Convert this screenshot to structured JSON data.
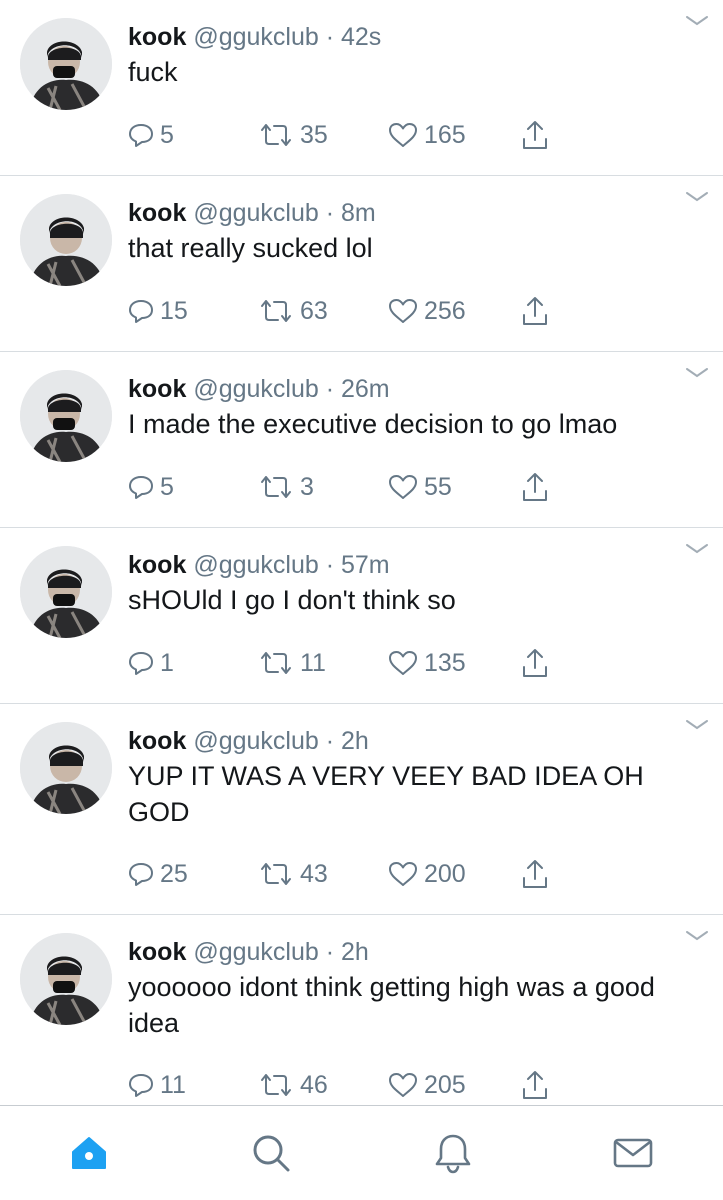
{
  "tweets": [
    {
      "name": "kook",
      "handle": "@ggukclub",
      "separator": "·",
      "time": "42s",
      "text": "fuck",
      "replies": "5",
      "retweets": "35",
      "likes": "165"
    },
    {
      "name": "kook",
      "handle": "@ggukclub",
      "separator": "·",
      "time": "8m",
      "text": "that really sucked lol",
      "replies": "15",
      "retweets": "63",
      "likes": "256"
    },
    {
      "name": "kook",
      "handle": "@ggukclub",
      "separator": "·",
      "time": "26m",
      "text": "I made the executive decision to go lmao",
      "replies": "5",
      "retweets": "3",
      "likes": "55"
    },
    {
      "name": "kook",
      "handle": "@ggukclub",
      "separator": "·",
      "time": "57m",
      "text": "sHOUld I go I don't think so",
      "replies": "1",
      "retweets": "11",
      "likes": "135"
    },
    {
      "name": "kook",
      "handle": "@ggukclub",
      "separator": "·",
      "time": "2h",
      "text": "YUP IT WAS A VERY VEEY BAD IDEA OH GOD",
      "replies": "25",
      "retweets": "43",
      "likes": "200"
    },
    {
      "name": "kook",
      "handle": "@ggukclub",
      "separator": "·",
      "time": "2h",
      "text": "yoooooo idont think getting high was a good idea",
      "replies": "11",
      "retweets": "46",
      "likes": "205"
    }
  ],
  "tabbar": {
    "items": [
      {
        "icon": "home-icon",
        "active": true
      },
      {
        "icon": "search-icon",
        "active": false
      },
      {
        "icon": "bell-icon",
        "active": false
      },
      {
        "icon": "mail-icon",
        "active": false
      }
    ]
  },
  "colors": {
    "accent": "#1da1f2",
    "secondary_text": "#657786",
    "primary_text": "#14171a",
    "divider": "#d8dde1"
  }
}
